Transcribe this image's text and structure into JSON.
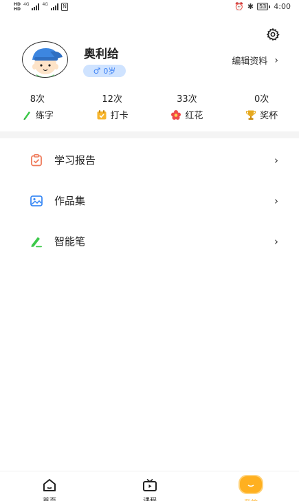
{
  "status_bar": {
    "left_tags": [
      "HD",
      "4G",
      "4G"
    ],
    "time": "4:00",
    "battery": "53"
  },
  "profile": {
    "name": "奥利给",
    "gender_symbol": "♂",
    "age": "0岁",
    "edit_label": "编辑资料"
  },
  "stats": [
    {
      "count": "8次",
      "label": "练字",
      "icon": "pencil-icon",
      "color": "#3cc94a"
    },
    {
      "count": "12次",
      "label": "打卡",
      "icon": "calendar-check-icon",
      "color": "#f7b52c"
    },
    {
      "count": "33次",
      "label": "红花",
      "icon": "red-flower-icon",
      "color": "#ef4a4a"
    },
    {
      "count": "0次",
      "label": "奖杯",
      "icon": "trophy-icon",
      "color": "#d89b1a"
    }
  ],
  "menu": [
    {
      "label": "学习报告",
      "icon": "report-icon",
      "color": "#ef7a5a"
    },
    {
      "label": "作品集",
      "icon": "gallery-icon",
      "color": "#3d8bf5"
    },
    {
      "label": "智能笔",
      "icon": "smart-pen-icon",
      "color": "#3cc94a"
    }
  ],
  "bottom_nav": [
    {
      "label": "首页",
      "icon": "home-icon"
    },
    {
      "label": "课程",
      "icon": "tv-icon"
    },
    {
      "label": "我的",
      "icon": "me-icon"
    }
  ],
  "colors": {
    "accent": "#ffb020",
    "badge_bg": "#cfe3ff",
    "badge_text": "#3d82f5"
  }
}
